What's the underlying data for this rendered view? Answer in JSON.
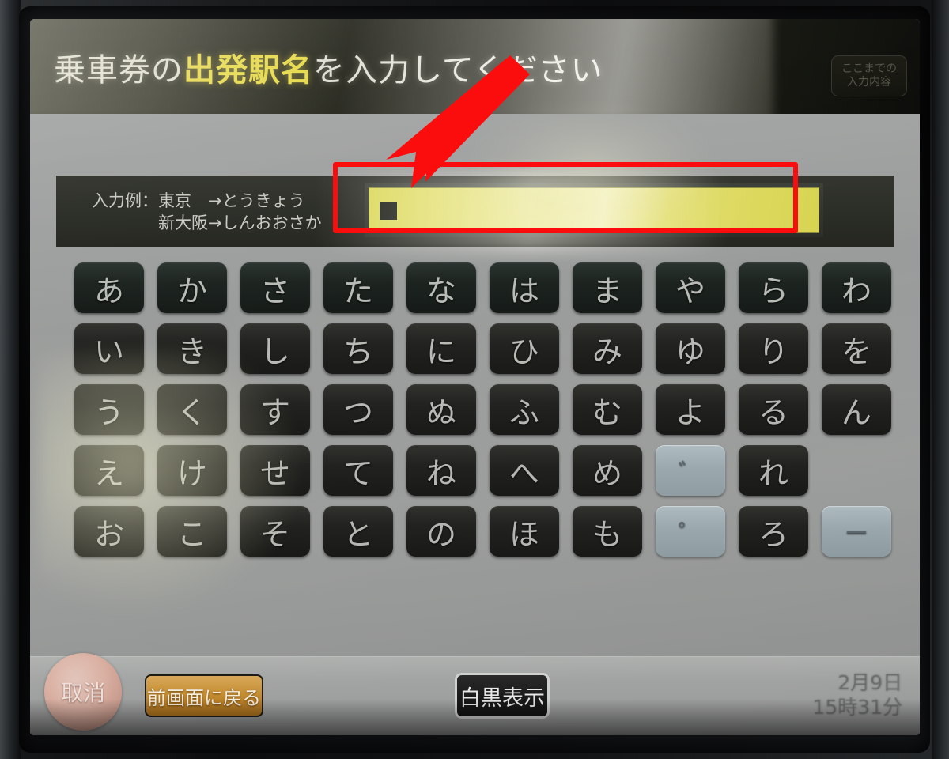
{
  "header": {
    "title_prefix": "乗車券の",
    "title_highlight": "出発駅名",
    "title_suffix": "を入力してください",
    "history_button_line1": "ここまでの",
    "history_button_line2": "入力内容"
  },
  "entry": {
    "example_label": "入力例：東京　→とうきょう\n　　　　新大阪→しんおおさか",
    "input_value": "",
    "input_placeholder": ""
  },
  "keypad": {
    "rows": [
      [
        {
          "label": "あ",
          "type": "head"
        },
        {
          "label": "か",
          "type": "head"
        },
        {
          "label": "さ",
          "type": "head"
        },
        {
          "label": "た",
          "type": "head"
        },
        {
          "label": "な",
          "type": "head"
        },
        {
          "label": "は",
          "type": "head"
        },
        {
          "label": "ま",
          "type": "head"
        },
        {
          "label": "や",
          "type": "head"
        },
        {
          "label": "ら",
          "type": "head"
        },
        {
          "label": "わ",
          "type": "head"
        }
      ],
      [
        {
          "label": "い",
          "type": "norm"
        },
        {
          "label": "き",
          "type": "norm"
        },
        {
          "label": "し",
          "type": "norm"
        },
        {
          "label": "ち",
          "type": "norm"
        },
        {
          "label": "に",
          "type": "norm"
        },
        {
          "label": "ひ",
          "type": "norm"
        },
        {
          "label": "み",
          "type": "norm"
        },
        {
          "label": "ゆ",
          "type": "norm"
        },
        {
          "label": "り",
          "type": "norm"
        },
        {
          "label": "を",
          "type": "norm"
        }
      ],
      [
        {
          "label": "う",
          "type": "norm"
        },
        {
          "label": "く",
          "type": "norm"
        },
        {
          "label": "す",
          "type": "norm"
        },
        {
          "label": "つ",
          "type": "norm"
        },
        {
          "label": "ぬ",
          "type": "norm"
        },
        {
          "label": "ふ",
          "type": "norm"
        },
        {
          "label": "む",
          "type": "norm"
        },
        {
          "label": "よ",
          "type": "norm"
        },
        {
          "label": "る",
          "type": "norm"
        },
        {
          "label": "ん",
          "type": "norm"
        }
      ],
      [
        {
          "label": "え",
          "type": "norm"
        },
        {
          "label": "け",
          "type": "norm"
        },
        {
          "label": "せ",
          "type": "norm"
        },
        {
          "label": "て",
          "type": "norm"
        },
        {
          "label": "ね",
          "type": "norm"
        },
        {
          "label": "へ",
          "type": "norm"
        },
        {
          "label": "め",
          "type": "norm"
        },
        {
          "label": "゛",
          "type": "special"
        },
        {
          "label": "れ",
          "type": "norm"
        },
        {
          "label": "",
          "type": "blank"
        }
      ],
      [
        {
          "label": "お",
          "type": "norm"
        },
        {
          "label": "こ",
          "type": "norm"
        },
        {
          "label": "そ",
          "type": "norm"
        },
        {
          "label": "と",
          "type": "norm"
        },
        {
          "label": "の",
          "type": "norm"
        },
        {
          "label": "ほ",
          "type": "norm"
        },
        {
          "label": "も",
          "type": "norm"
        },
        {
          "label": "゜",
          "type": "special"
        },
        {
          "label": "ろ",
          "type": "norm"
        },
        {
          "label": "ー",
          "type": "special"
        }
      ]
    ]
  },
  "toolbar": {
    "cancel_label": "取消",
    "back_label": "前画面に戻る",
    "bw_label": "白黒表示",
    "date_text": "2月9日",
    "time_text": "15時31分"
  },
  "colors": {
    "accent_yellow": "#f2e23c",
    "input_field": "#e2de6e",
    "annotation_red": "#fc0d0d",
    "back_button_orange": "#cf9637",
    "cancel_pink": "#e6b8a9",
    "special_key_blue": "#9fadb3"
  }
}
